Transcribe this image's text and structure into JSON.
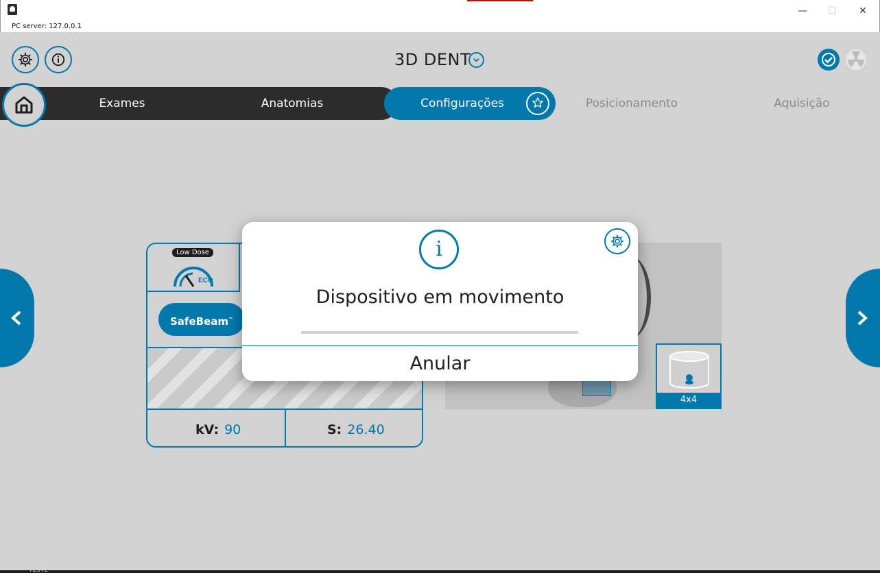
{
  "window": {
    "server_label": "PC server: 127.0.0.1",
    "minimize": "—",
    "maximize": "☐",
    "close": "✕"
  },
  "header": {
    "title": "3D DENT",
    "icons": [
      "gear-icon",
      "info-icon",
      "chevron-down-icon",
      "check-icon",
      "radiation-icon"
    ]
  },
  "nav": {
    "tabs": [
      {
        "label": "Exames",
        "state": "done"
      },
      {
        "label": "Anatomias",
        "state": "done"
      },
      {
        "label": "Configurações",
        "state": "active"
      },
      {
        "label": "Posicionamento",
        "state": "pending"
      },
      {
        "label": "Aquisição",
        "state": "pending"
      }
    ]
  },
  "card": {
    "low_dose_badge": "Low Dose",
    "eco_label": "ECO",
    "safebeam_label": "SafeBeam",
    "trademark": "™",
    "kv_label": "kV:",
    "kv_value": "90",
    "s_label": "S:",
    "s_value": "26.40"
  },
  "preview": {
    "fov_label": "4x4"
  },
  "modal": {
    "info_glyph": "i",
    "message": "Dispositivo em movimento",
    "progress": 0.0,
    "cancel_label": "Anular"
  },
  "taskbar": {
    "text": "TESTE"
  },
  "colors": {
    "accent": "#0078aa",
    "dark_nav": "#2c2c2c",
    "background": "#d2d2d2"
  }
}
